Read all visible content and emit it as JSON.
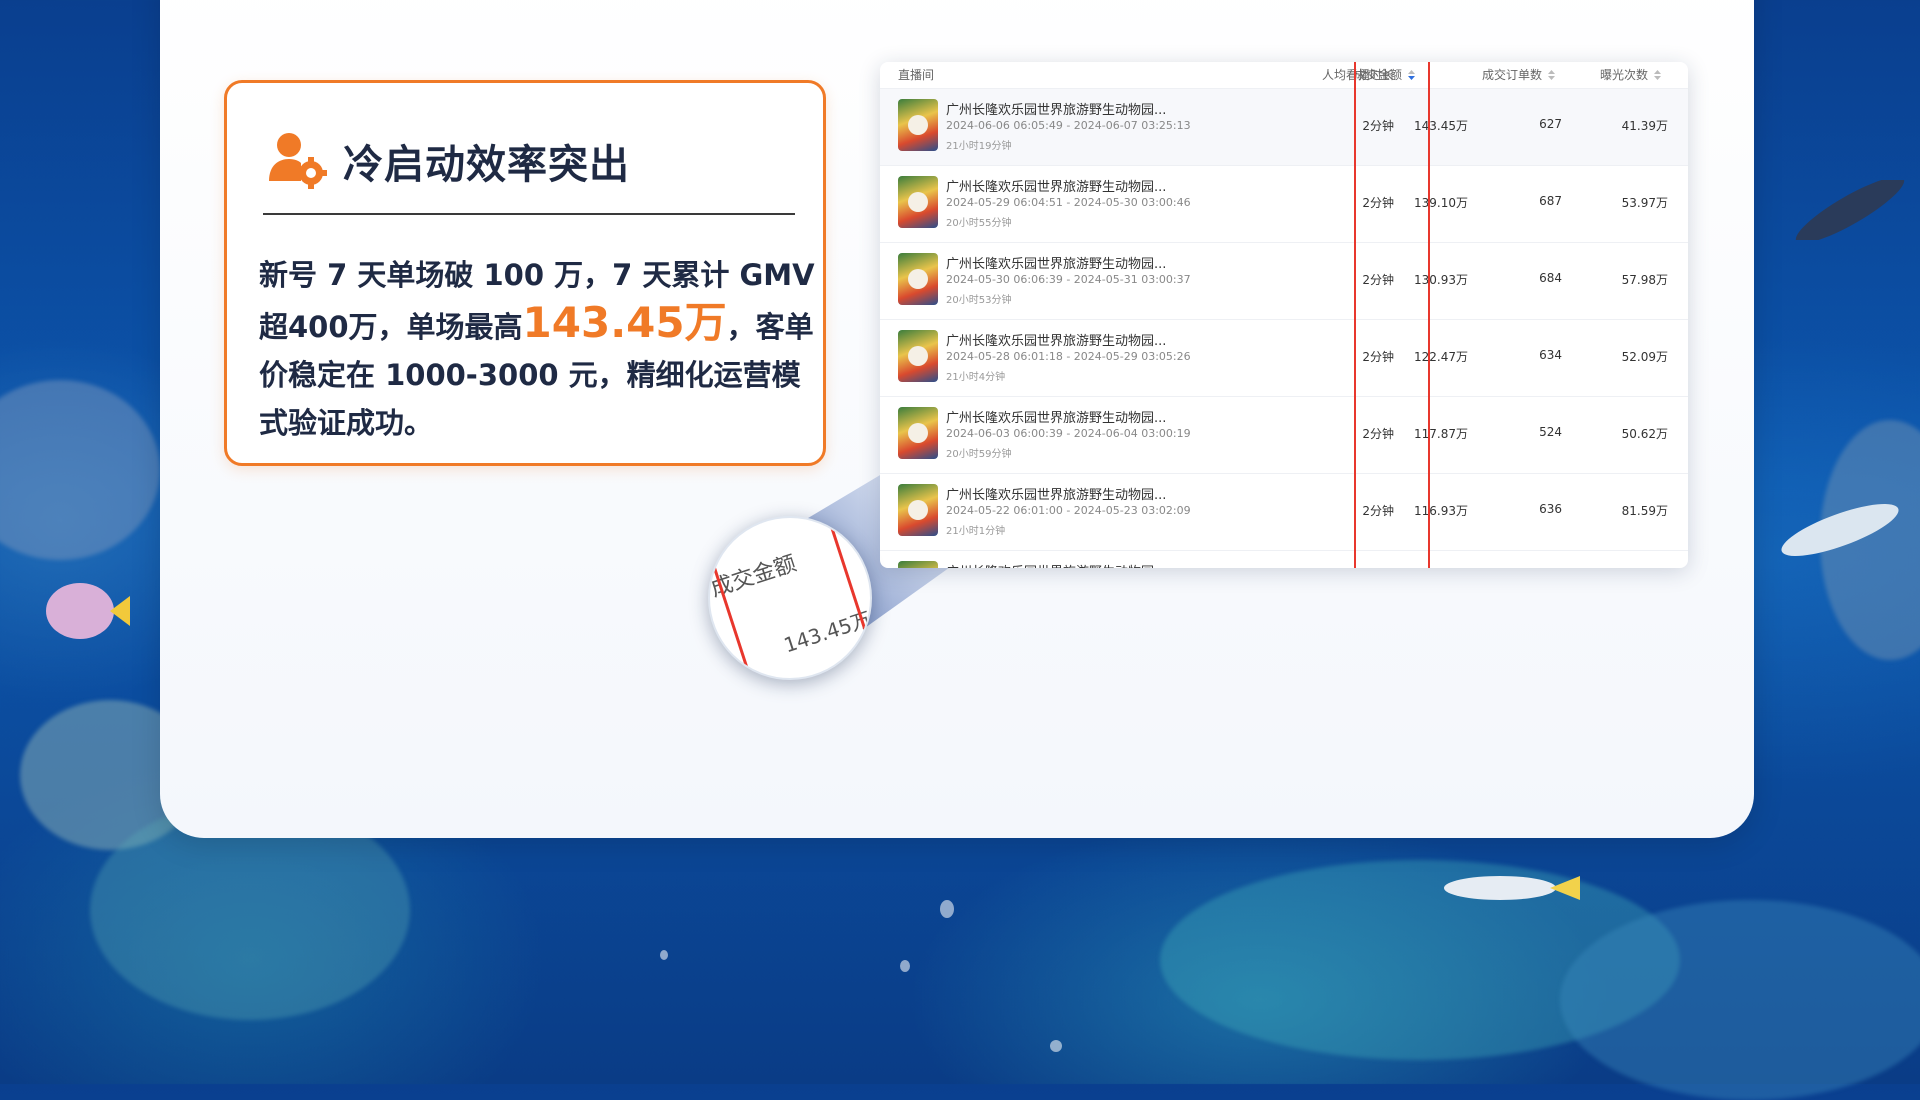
{
  "card": {
    "title": "冷启动效率突出",
    "body_part1": "新号 7 天单场破 100 万，7 天累计 GMV 超400万，单场最高",
    "highlight": "143.45万",
    "body_part2": "，客单价稳定在 1000-3000 元，精细化运营模式验证成功。",
    "accent_color": "#f07a27",
    "icon": "user-gear-icon"
  },
  "table": {
    "headers": {
      "room": "直播间",
      "avg_watch": "人均看播时长",
      "gmv": "成交金额",
      "orders": "成交订单数",
      "exposure": "曝光次数"
    },
    "rows": [
      {
        "title": "广州长隆欢乐园世界旅游野生动物园...",
        "time": "2024-06-06 06:05:49 - 2024-06-07 03:25:13",
        "duration": "21小时19分钟",
        "avg": "2分钟",
        "gmv": "143.45万",
        "orders": "627",
        "exposure": "41.39万"
      },
      {
        "title": "广州长隆欢乐园世界旅游野生动物园...",
        "time": "2024-05-29 06:04:51 - 2024-05-30 03:00:46",
        "duration": "20小时55分钟",
        "avg": "2分钟",
        "gmv": "139.10万",
        "orders": "687",
        "exposure": "53.97万"
      },
      {
        "title": "广州长隆欢乐园世界旅游野生动物园...",
        "time": "2024-05-30 06:06:39 - 2024-05-31 03:00:37",
        "duration": "20小时53分钟",
        "avg": "2分钟",
        "gmv": "130.93万",
        "orders": "684",
        "exposure": "57.98万"
      },
      {
        "title": "广州长隆欢乐园世界旅游野生动物园...",
        "time": "2024-05-28 06:01:18 - 2024-05-29 03:05:26",
        "duration": "21小时4分钟",
        "avg": "2分钟",
        "gmv": "122.47万",
        "orders": "634",
        "exposure": "52.09万"
      },
      {
        "title": "广州长隆欢乐园世界旅游野生动物园...",
        "time": "2024-06-03 06:00:39 - 2024-06-04 03:00:19",
        "duration": "20小时59分钟",
        "avg": "2分钟",
        "gmv": "117.87万",
        "orders": "524",
        "exposure": "50.62万"
      },
      {
        "title": "广州长隆欢乐园世界旅游野生动物园...",
        "time": "2024-05-22 06:01:00 - 2024-05-23 03:02:09",
        "duration": "21小时1分钟",
        "avg": "2分钟",
        "gmv": "116.93万",
        "orders": "636",
        "exposure": "81.59万"
      },
      {
        "title": "广州长隆欢乐园世界旅游野生动物园...",
        "time": "",
        "duration": "",
        "avg": "",
        "gmv": "",
        "orders": "",
        "exposure": ""
      }
    ],
    "highlight_color": "#e8372d"
  },
  "magnifier": {
    "header": "成交金额",
    "value": "143.45万"
  }
}
